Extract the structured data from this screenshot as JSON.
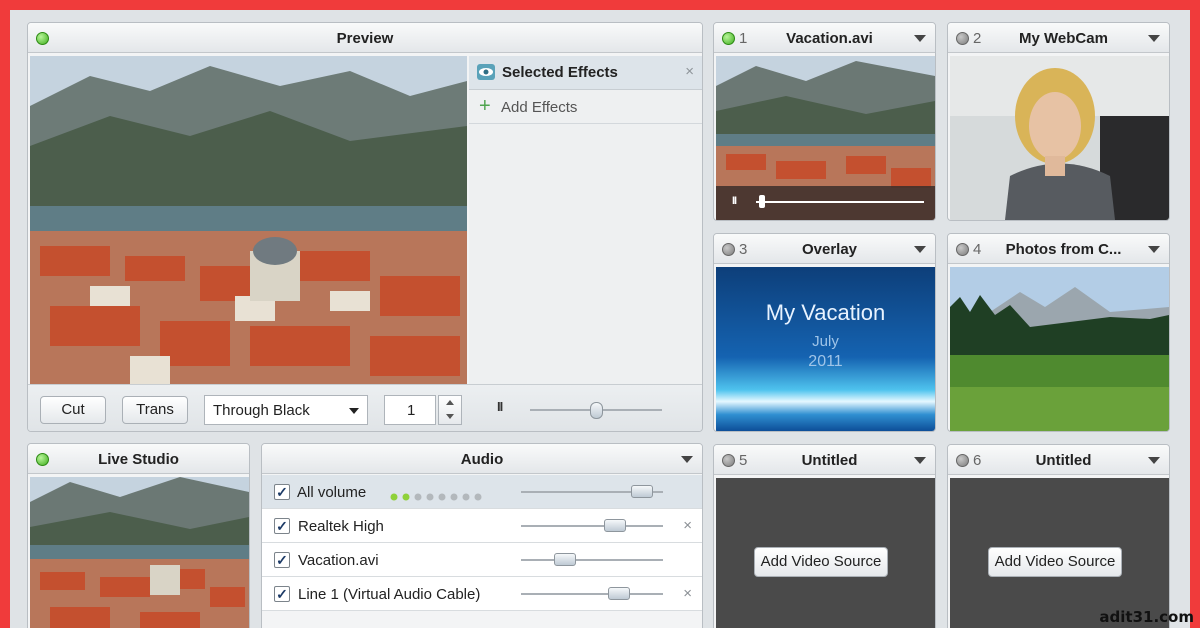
{
  "preview": {
    "title": "Preview",
    "effects_title": "Selected Effects",
    "add_effects": "Add Effects",
    "cut_label": "Cut",
    "trans_label": "Trans",
    "transition_value": "Through Black",
    "duration_value": "1",
    "pause_glyph": "II"
  },
  "sources": [
    {
      "num": "1",
      "title": "Vacation.avi",
      "status": "green"
    },
    {
      "num": "2",
      "title": "My WebCam",
      "status": "grey"
    },
    {
      "num": "3",
      "title": "Overlay",
      "status": "grey"
    },
    {
      "num": "4",
      "title": "Photos from C...",
      "status": "grey"
    },
    {
      "num": "5",
      "title": "Untitled",
      "status": "grey",
      "button": "Add Video Source"
    },
    {
      "num": "6",
      "title": "Untitled",
      "status": "grey",
      "button": "Add Video Source"
    }
  ],
  "overlay_text": {
    "line1": "My Vacation",
    "line2": "July",
    "line3": "2011"
  },
  "live_studio": {
    "title": "Live Studio"
  },
  "audio": {
    "title": "Audio",
    "rows": [
      {
        "label": "All volume",
        "level": 0.85
      },
      {
        "label": "Realtek High",
        "level": 0.66
      },
      {
        "label": "Vacation.avi",
        "level": 0.31
      },
      {
        "label": "Line 1 (Virtual Audio Cable)",
        "level": 0.69
      }
    ]
  },
  "vacation_playback": {
    "progress": 0.02
  },
  "preview_slider": {
    "level": 0.5
  },
  "watermark": "adit31.com",
  "colors": {
    "accent_green": "#3fae1e",
    "frame_red": "#f03b3b"
  }
}
